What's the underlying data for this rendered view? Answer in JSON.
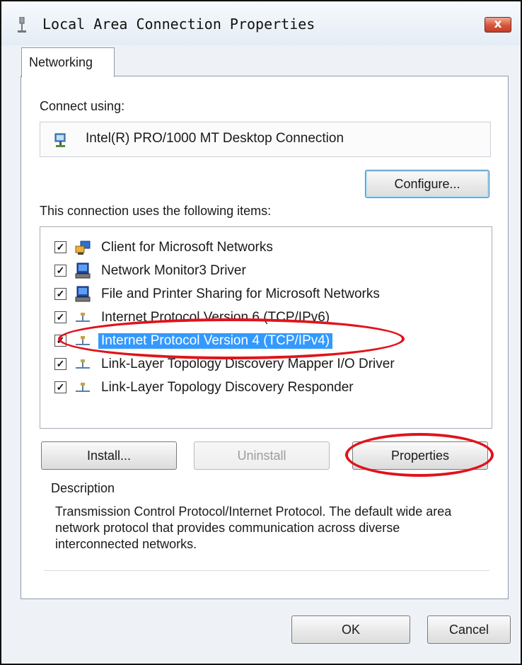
{
  "window": {
    "title": "Local Area Connection Properties",
    "close_label": "x"
  },
  "tabs": [
    {
      "label": "Networking",
      "selected": true
    }
  ],
  "connect": {
    "label": "Connect using:",
    "adapter_name": "Intel(R) PRO/1000 MT Desktop Connection",
    "configure_label": "Configure..."
  },
  "items": {
    "label": "This connection uses the following items:",
    "list": [
      {
        "label": "Client for Microsoft Networks",
        "checked": true,
        "icon": "network-client-icon"
      },
      {
        "label": "Network Monitor3 Driver",
        "checked": true,
        "icon": "network-service-icon"
      },
      {
        "label": "File and Printer Sharing for Microsoft Networks",
        "checked": true,
        "icon": "network-service-icon"
      },
      {
        "label": "Internet Protocol Version 6 (TCP/IPv6)",
        "checked": true,
        "icon": "protocol-icon"
      },
      {
        "label": "Internet Protocol Version 4 (TCP/IPv4)",
        "checked": true,
        "icon": "protocol-icon",
        "selected": true
      },
      {
        "label": "Link-Layer Topology Discovery Mapper I/O Driver",
        "checked": true,
        "icon": "protocol-icon"
      },
      {
        "label": "Link-Layer Topology Discovery Responder",
        "checked": true,
        "icon": "protocol-icon"
      }
    ]
  },
  "buttons": {
    "install": "Install...",
    "uninstall": "Uninstall",
    "properties": "Properties",
    "ok": "OK",
    "cancel": "Cancel"
  },
  "description": {
    "label": "Description",
    "text": "Transmission Control Protocol/Internet Protocol. The default wide area network protocol that provides communication across diverse interconnected networks."
  },
  "colors": {
    "annotation": "#e0131b",
    "selection": "#3399ff"
  }
}
